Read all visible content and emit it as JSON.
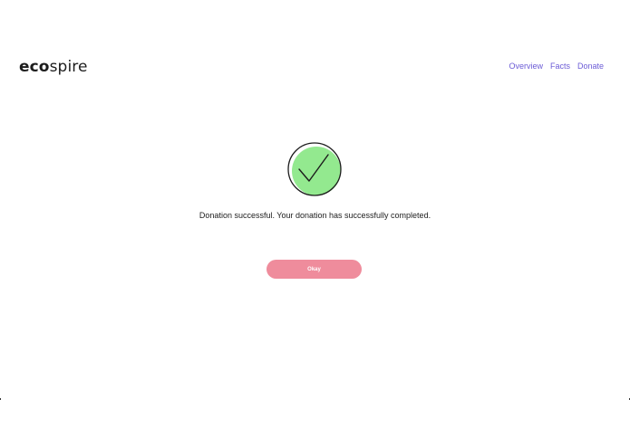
{
  "brand": {
    "logo_bold": "eco",
    "logo_light": "spire"
  },
  "nav": {
    "items": [
      {
        "label": "Overview"
      },
      {
        "label": "Facts"
      },
      {
        "label": "Donate"
      }
    ],
    "link_color": "#6b5bd6"
  },
  "status": {
    "icon": "check-circle-icon",
    "icon_fill": "#93e98f",
    "message": "Donation successful. Your donation has successfully completed."
  },
  "actions": {
    "okay_label": "Okay",
    "button_color": "#ef8c9c"
  }
}
